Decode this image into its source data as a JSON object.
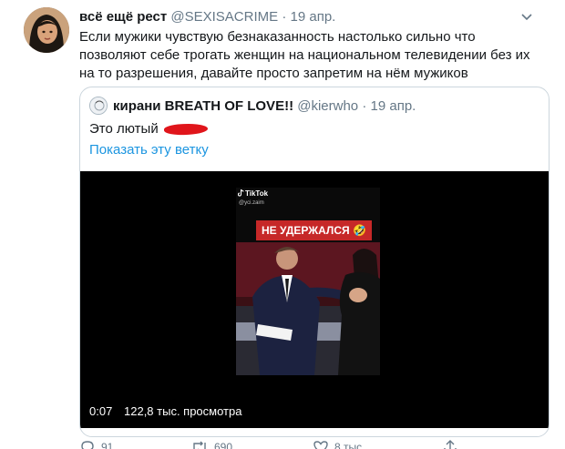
{
  "tweet": {
    "author_name": "всё ещё рест",
    "handle": "@SEXISACRIME",
    "separator": "·",
    "date": "19 апр.",
    "text_lines": [
      "Если мужики чувствую безнаказанность настолько сильно что",
      "позволяют себе трогать женщин на национальном телевидении без их",
      "на то разрешения, давайте просто запретим на нём мужиков"
    ]
  },
  "quote": {
    "author_name": "кирани BREATH OF LOVE!!",
    "handle": "@kierwho",
    "separator": "·",
    "date": "19 апр.",
    "text": "Это лютый",
    "show_thread": "Показать эту ветку",
    "media": {
      "watermark": "TikTok",
      "watermark_handle": "@yci.zaim",
      "caption": "НЕ УДЕРЖАЛСЯ 🤣",
      "duration": "0:07",
      "views": "122,8 тыс. просмотра"
    }
  },
  "actions": {
    "replies": "91",
    "retweets": "690",
    "likes": "8 тыс."
  },
  "colors": {
    "link": "#1b95e0",
    "secondary_text": "#657786",
    "border": "#ccd6dd",
    "redaction": "#e0151b",
    "caption_bg": "#c62828"
  }
}
